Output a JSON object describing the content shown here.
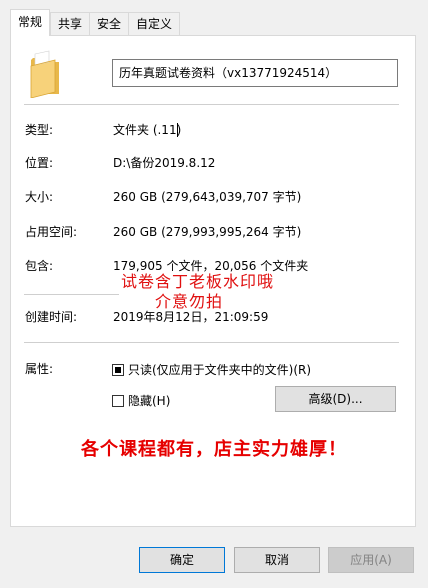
{
  "tabs": [
    "常规",
    "共享",
    "安全",
    "自定义"
  ],
  "name": "历年真题试卷资料（vx13771924514）",
  "rows": {
    "type": {
      "label": "类型:",
      "value": "文件夹 (.11)"
    },
    "location": {
      "label": "位置:",
      "value": "D:\\备份2019.8.12"
    },
    "size": {
      "label": "大小:",
      "value": "260 GB (279,643,039,707 字节)"
    },
    "disk_size": {
      "label": "占用空间:",
      "value": "260 GB (279,993,995,264 字节)"
    },
    "contains": {
      "label": "包含:",
      "value": "179,905 个文件，20,056 个文件夹"
    },
    "created": {
      "label": "创建时间:",
      "value": "2019年8月12日，21:09:59"
    }
  },
  "attributes": {
    "label": "属性:",
    "readonly": {
      "label": "只读(仅应用于文件夹中的文件)(R)",
      "checked": true
    },
    "hidden": {
      "label": "隐藏(H)",
      "checked": false
    },
    "advanced_button": "高级(D)..."
  },
  "watermark": {
    "line1": "试卷含丁老板水印哦",
    "line2": "介意勿拍"
  },
  "promo": "各个课程都有，店主实力雄厚！",
  "buttons": {
    "ok": "确定",
    "cancel": "取消",
    "apply": "应用(A)"
  },
  "colors": {
    "watermark": "#e01010",
    "promo": "#e60000",
    "default_button_border": "#0078d7"
  }
}
